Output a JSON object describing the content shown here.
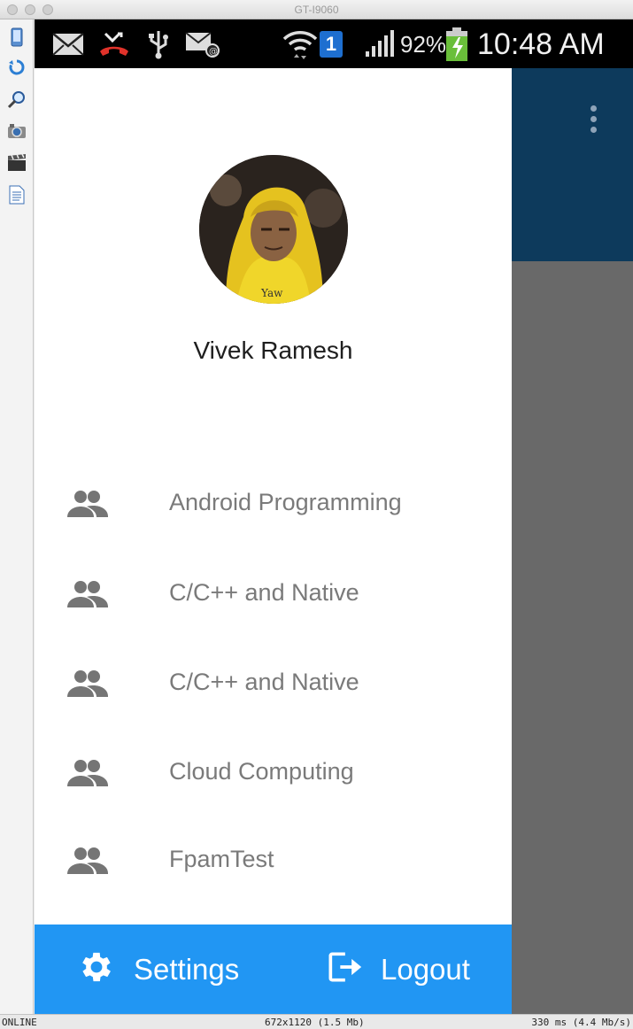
{
  "window": {
    "title": "GT-I9060"
  },
  "statusbar": {
    "battery_percent": "92%",
    "time": "10:48 AM",
    "sim_badge": "1"
  },
  "drawer": {
    "profile_name": "Vivek Ramesh",
    "items": [
      {
        "label": "Android Programming",
        "icon": "group-icon"
      },
      {
        "label": "C/C++ and Native",
        "icon": "group-icon"
      },
      {
        "label": "C/C++ and Native",
        "icon": "group-icon"
      },
      {
        "label": "Cloud Computing",
        "icon": "group-icon"
      },
      {
        "label": "FpamTest",
        "icon": "group-icon"
      }
    ],
    "settings_label": "Settings",
    "logout_label": "Logout"
  },
  "footer": {
    "status": "ONLINE",
    "resolution": "672x1120 (1.5 Mb)",
    "latency": "330 ms (4.4 Mb/s)"
  },
  "colors": {
    "drawer_bottom": "#2196f3",
    "appbar": "#0d3a5c",
    "scrim": "#696969"
  }
}
